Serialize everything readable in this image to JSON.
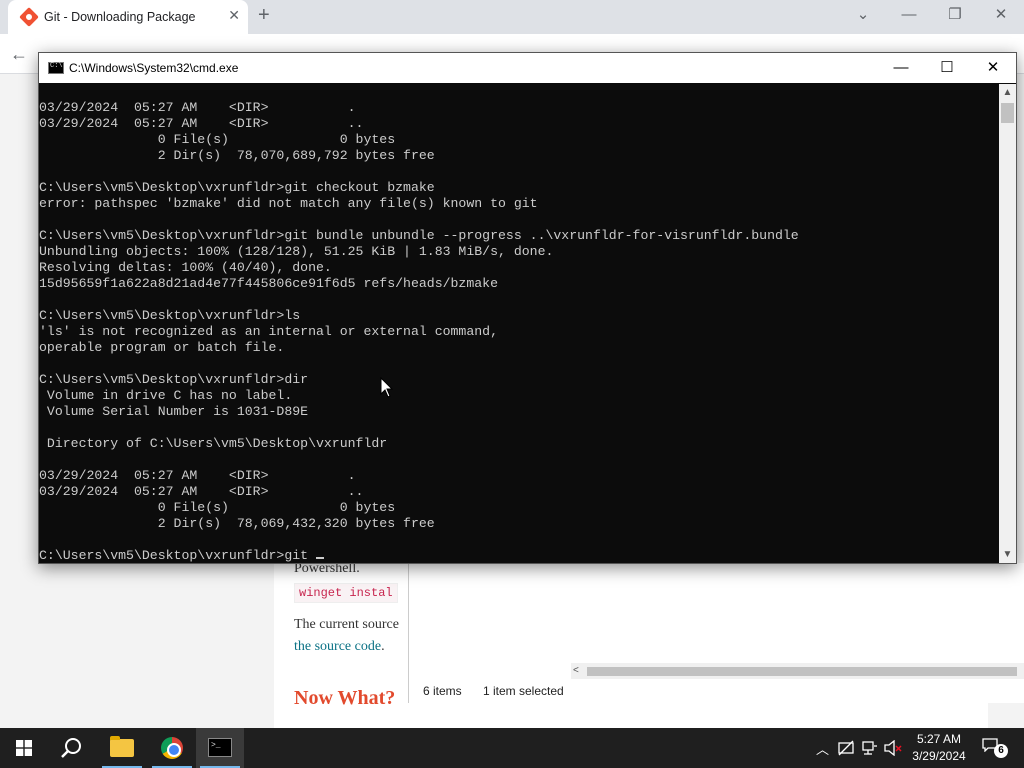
{
  "browser": {
    "tab_title": "Git - Downloading Package",
    "tab_close": "✕",
    "new_tab": "+",
    "controls": {
      "dropdown": "⌄",
      "minimize": "—",
      "restore": "❐",
      "close": "✕"
    },
    "back": "←"
  },
  "article": {
    "para1": "Powershell.",
    "code1": "winget instal",
    "para2": "The current source",
    "link1": "the source code",
    "link1_after": ".",
    "heading": "Now What?",
    "link_color": "#0b7285",
    "heading_color": "#e24a2d"
  },
  "explorer": {
    "items_count": "6 items",
    "selected": "1 item selected",
    "scroll_left": "<"
  },
  "cmd": {
    "title": "C:\\Windows\\System32\\cmd.exe",
    "controls": {
      "minimize": "—",
      "maximize": "☐",
      "close": "✕"
    },
    "lines": [
      "03/29/2024  05:27 AM    <DIR>          .",
      "03/29/2024  05:27 AM    <DIR>          ..",
      "               0 File(s)              0 bytes",
      "               2 Dir(s)  78,070,689,792 bytes free",
      "",
      "C:\\Users\\vm5\\Desktop\\vxrunfldr>git checkout bzmake",
      "error: pathspec 'bzmake' did not match any file(s) known to git",
      "",
      "C:\\Users\\vm5\\Desktop\\vxrunfldr>git bundle unbundle --progress ..\\vxrunfldr-for-visrunfldr.bundle",
      "Unbundling objects: 100% (128/128), 51.25 KiB | 1.83 MiB/s, done.",
      "Resolving deltas: 100% (40/40), done.",
      "15d95659f1a622a8d21ad4e77f445806ce91f6d5 refs/heads/bzmake",
      "",
      "C:\\Users\\vm5\\Desktop\\vxrunfldr>ls",
      "'ls' is not recognized as an internal or external command,",
      "operable program or batch file.",
      "",
      "C:\\Users\\vm5\\Desktop\\vxrunfldr>dir",
      " Volume in drive C has no label.",
      " Volume Serial Number is 1031-D89E",
      "",
      " Directory of C:\\Users\\vm5\\Desktop\\vxrunfldr",
      "",
      "03/29/2024  05:27 AM    <DIR>          .",
      "03/29/2024  05:27 AM    <DIR>          ..",
      "               0 File(s)              0 bytes",
      "               2 Dir(s)  78,069,432,320 bytes free",
      ""
    ],
    "prompt_line": "C:\\Users\\vm5\\Desktop\\vxrunfldr>git ",
    "text_color": "#cccccc",
    "background": "#0c0c0c"
  },
  "taskbar": {
    "start_icon": "windows-logo-icon",
    "search_icon": "search-icon",
    "apps": [
      "file-explorer",
      "chrome",
      "cmd"
    ],
    "clock_time": "5:27 AM",
    "clock_date": "3/29/2024",
    "notification_count": "6"
  }
}
